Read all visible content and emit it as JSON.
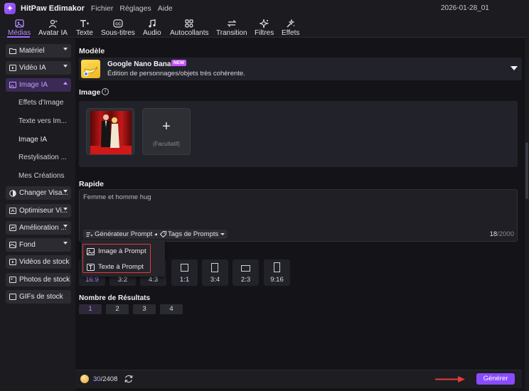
{
  "app": {
    "title": "HitPaw Edimakor",
    "menu": [
      "Fichier",
      "Réglages",
      "Aide"
    ],
    "project_name": "2026-01-28_01"
  },
  "toolbar": {
    "tabs": [
      {
        "label": "Médias",
        "icon": "media-icon",
        "active": true
      },
      {
        "label": "Avatar IA",
        "icon": "avatar-icon"
      },
      {
        "label": "Texte",
        "icon": "text-icon"
      },
      {
        "label": "Sous-titres",
        "icon": "subtitles-icon"
      },
      {
        "label": "Audio",
        "icon": "music-note-icon"
      },
      {
        "label": "Autocollants",
        "icon": "stickers-icon"
      },
      {
        "label": "Transition",
        "icon": "transition-icon"
      },
      {
        "label": "Filtres",
        "icon": "filter-icon"
      },
      {
        "label": "Effets",
        "icon": "effects-icon"
      }
    ],
    "accent": "#a66cff"
  },
  "sidebar": {
    "categories": [
      {
        "label": "Matériel"
      },
      {
        "label": "Vidéo IA"
      },
      {
        "label": "Image IA",
        "open": true
      },
      {
        "label": "Changer Visa..."
      },
      {
        "label": "Optimiseur Vi..."
      },
      {
        "label": "Amélioration ..."
      },
      {
        "label": "Fond"
      },
      {
        "label": "Vidéos de stock"
      },
      {
        "label": "Photos de stock"
      },
      {
        "label": "GIFs de stock"
      }
    ],
    "subitems": [
      {
        "label": "Effets d'Image"
      },
      {
        "label": "Texte vers Im..."
      },
      {
        "label": "Image IA",
        "selected": true
      },
      {
        "label": "Restylisation ..."
      },
      {
        "label": "Mes Créations"
      }
    ]
  },
  "main": {
    "model_label": "Modèle",
    "model": {
      "name": "Google Nano Banana",
      "badge": "NEW",
      "description": "Édition de personnages/objets très cohérente."
    },
    "image_label": "Image",
    "add_slot_label": "(Facultatif)",
    "prompt_label": "Rapide",
    "prompt_text": "Femme et homme hug",
    "prompt_generator_label": "Générateur Prompt",
    "prompt_tags_label": "Tags de Prompts",
    "char_count": "18",
    "char_max": "/2000",
    "popup": {
      "items": [
        {
          "label": "Image à Prompt",
          "icon": "image-icon"
        },
        {
          "label": "Texte à Prompt",
          "icon": "text-box-icon"
        }
      ],
      "highlight_color": "#e53a3a"
    },
    "ratios": [
      {
        "label": "16:9",
        "active": true
      },
      {
        "label": "3:2"
      },
      {
        "label": "4:3"
      },
      {
        "label": "1:1"
      },
      {
        "label": "3:4"
      },
      {
        "label": "2:3"
      },
      {
        "label": "9:16"
      }
    ],
    "results_label": "Nombre de Résultats",
    "results": [
      "1",
      "2",
      "3",
      "4"
    ],
    "credits_used": "30",
    "credits_total": "/2408",
    "generate_label": "Générer",
    "generate_color": "#8a4bff"
  }
}
